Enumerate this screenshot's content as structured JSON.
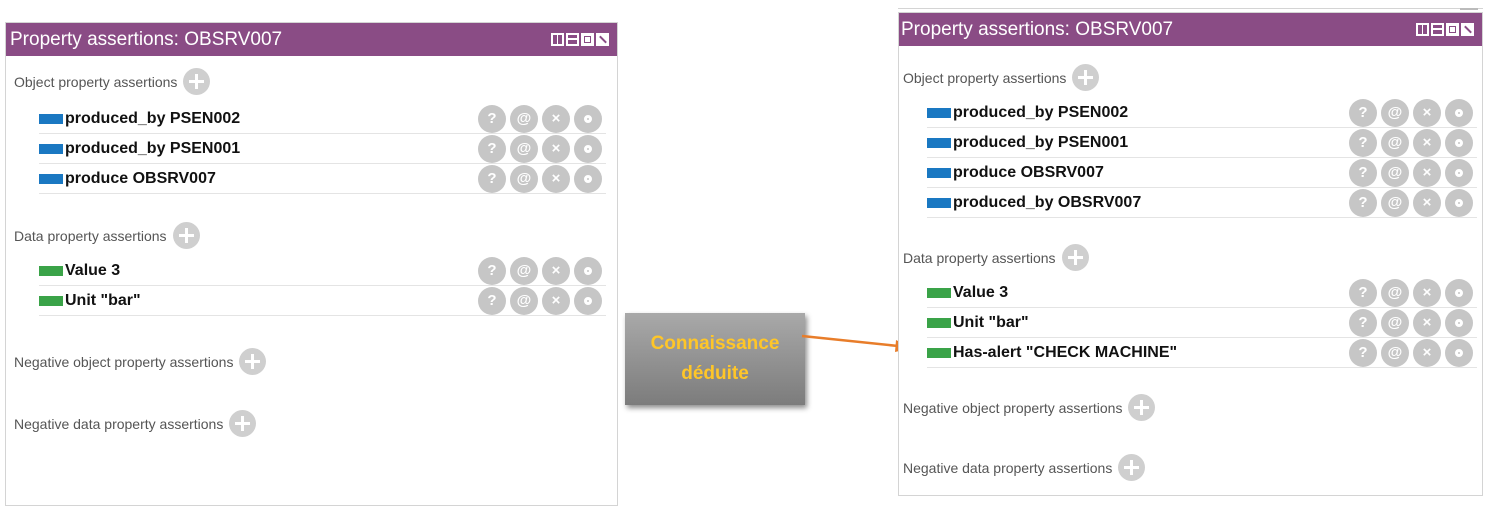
{
  "left_panel": {
    "title": "Property assertions: OBSRV007",
    "sections": {
      "object_label": "Object property assertions",
      "data_label": "Data property assertions",
      "neg_object_label": "Negative object property assertions",
      "neg_data_label": "Negative data property assertions"
    },
    "object_rows": [
      "produced_by  PSEN002",
      "produced_by  PSEN001",
      "produce  OBSRV007"
    ],
    "data_rows": [
      "Value  3",
      "Unit  \"bar\""
    ]
  },
  "right_panel": {
    "title": "Property assertions: OBSRV007",
    "sections": {
      "object_label": "Object property assertions",
      "data_label": "Data property assertions",
      "neg_object_label": "Negative object property assertions",
      "neg_data_label": "Negative data property assertions"
    },
    "object_rows": [
      "produced_by  PSEN002",
      "produced_by  PSEN001",
      "produce  OBSRV007",
      "produced_by  OBSRV007"
    ],
    "data_rows": [
      "Value  3",
      "Unit  \"bar\"",
      "Has-alert  \"CHECK MACHINE\""
    ]
  },
  "action_icons": {
    "explain": "?",
    "annotate": "@",
    "delete": "×"
  },
  "callout": {
    "line1": "Connaissance",
    "line2": "déduite"
  },
  "colors": {
    "titlebar": "#8a4c85",
    "object_swatch": "#1a78c2",
    "data_swatch": "#3aa348",
    "callout_text": "#ffc628",
    "arrow": "#e87d2a"
  }
}
